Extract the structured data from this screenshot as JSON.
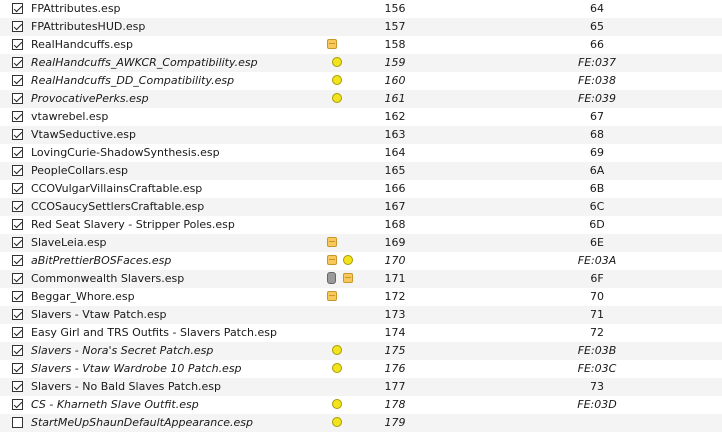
{
  "plugins": [
    {
      "name": "FPAttributes.esp",
      "checked": true,
      "flags": [],
      "priority": "156",
      "index": "64",
      "light": false
    },
    {
      "name": "FPAttributesHUD.esp",
      "checked": true,
      "flags": [],
      "priority": "157",
      "index": "65",
      "light": false
    },
    {
      "name": "RealHandcuffs.esp",
      "checked": true,
      "flags": [
        "archive"
      ],
      "priority": "158",
      "index": "66",
      "light": false
    },
    {
      "name": "RealHandcuffs_AWKCR_Compatibility.esp",
      "checked": true,
      "flags": [
        "light"
      ],
      "priority": "159",
      "index": "FE:037",
      "light": true
    },
    {
      "name": "RealHandcuffs_DD_Compatibility.esp",
      "checked": true,
      "flags": [
        "light"
      ],
      "priority": "160",
      "index": "FE:038",
      "light": true
    },
    {
      "name": "ProvocativePerks.esp",
      "checked": true,
      "flags": [
        "light"
      ],
      "priority": "161",
      "index": "FE:039",
      "light": true
    },
    {
      "name": "vtawrebel.esp",
      "checked": true,
      "flags": [],
      "priority": "162",
      "index": "67",
      "light": false
    },
    {
      "name": "VtawSeductive.esp",
      "checked": true,
      "flags": [],
      "priority": "163",
      "index": "68",
      "light": false
    },
    {
      "name": "LovingCurie-ShadowSynthesis.esp",
      "checked": true,
      "flags": [],
      "priority": "164",
      "index": "69",
      "light": false
    },
    {
      "name": "PeopleCollars.esp",
      "checked": true,
      "flags": [],
      "priority": "165",
      "index": "6A",
      "light": false
    },
    {
      "name": "CCOVulgarVillainsCraftable.esp",
      "checked": true,
      "flags": [],
      "priority": "166",
      "index": "6B",
      "light": false
    },
    {
      "name": "CCOSaucySettlersCraftable.esp",
      "checked": true,
      "flags": [],
      "priority": "167",
      "index": "6C",
      "light": false
    },
    {
      "name": "Red Seat Slavery -  Stripper Poles.esp",
      "checked": true,
      "flags": [],
      "priority": "168",
      "index": "6D",
      "light": false
    },
    {
      "name": "SlaveLeia.esp",
      "checked": true,
      "flags": [
        "archive"
      ],
      "priority": "169",
      "index": "6E",
      "light": false
    },
    {
      "name": "aBitPrettierBOSFaces.esp",
      "checked": true,
      "flags": [
        "archive",
        "light"
      ],
      "priority": "170",
      "index": "FE:03A",
      "light": true
    },
    {
      "name": "Commonwealth Slavers.esp",
      "checked": true,
      "flags": [
        "attachment",
        "archive"
      ],
      "priority": "171",
      "index": "6F",
      "light": false
    },
    {
      "name": "Beggar_Whore.esp",
      "checked": true,
      "flags": [
        "archive"
      ],
      "priority": "172",
      "index": "70",
      "light": false
    },
    {
      "name": "Slavers - Vtaw Patch.esp",
      "checked": true,
      "flags": [],
      "priority": "173",
      "index": "71",
      "light": false
    },
    {
      "name": "Easy Girl and TRS Outfits - Slavers Patch.esp",
      "checked": true,
      "flags": [],
      "priority": "174",
      "index": "72",
      "light": false
    },
    {
      "name": "Slavers - Nora's Secret Patch.esp",
      "checked": true,
      "flags": [
        "light"
      ],
      "priority": "175",
      "index": "FE:03B",
      "light": true
    },
    {
      "name": "Slavers - Vtaw Wardrobe 10 Patch.esp",
      "checked": true,
      "flags": [
        "light"
      ],
      "priority": "176",
      "index": "FE:03C",
      "light": true
    },
    {
      "name": "Slavers - No Bald Slaves Patch.esp",
      "checked": true,
      "flags": [],
      "priority": "177",
      "index": "73",
      "light": false
    },
    {
      "name": "CS - Kharneth Slave Outfit.esp",
      "checked": true,
      "flags": [
        "light"
      ],
      "priority": "178",
      "index": "FE:03D",
      "light": true
    },
    {
      "name": "StartMeUpShaunDefaultAppearance.esp",
      "checked": false,
      "flags": [
        "light"
      ],
      "priority": "179",
      "index": "",
      "light": true
    }
  ],
  "icons": {
    "archive": "archive-box-icon",
    "light": "light-plugin-icon",
    "attachment": "attachment-icon"
  }
}
